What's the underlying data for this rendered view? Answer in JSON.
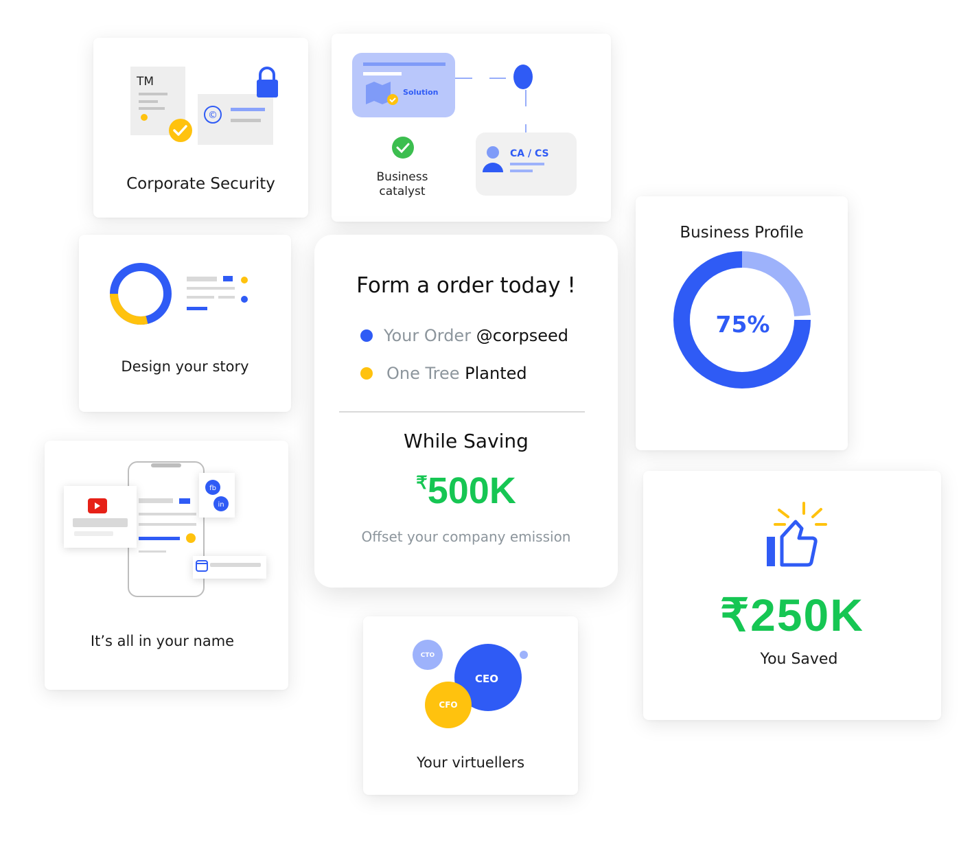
{
  "colors": {
    "blue": "#2f5bf5",
    "light_blue": "#9db2fb",
    "yellow": "#ffc20e",
    "green": "#16c653",
    "grey_text": "#8c959c"
  },
  "corporate_security": {
    "tm_label": "TM",
    "copyright_symbol": "©",
    "title": "Corporate Security"
  },
  "business_catalyst": {
    "solution_label": "Solution",
    "title_line1": "Business",
    "title_line2": "catalyst",
    "ca_cs_label": "CA / CS"
  },
  "design_story": {
    "title": "Design your story"
  },
  "order_card": {
    "heading": "Form a order today !",
    "item1_muted": "Your Order",
    "item1_strong": "@corpseed",
    "item2_muted": "One Tree",
    "item2_strong": "Planted",
    "saving_label": "While Saving",
    "currency_symbol": "₹",
    "amount": "500K",
    "note": "Offset your company emission"
  },
  "business_profile": {
    "title": "Business Profile",
    "percent_label": "75%",
    "completion": 0.75
  },
  "name_card": {
    "fb_label": "fb",
    "in_label": "in",
    "title": "It’s all in your name"
  },
  "virtuellers": {
    "cto_label": "CTO",
    "ceo_label": "CEO",
    "cfo_label": "CFO",
    "title": "Your virtuellers"
  },
  "saved_card": {
    "amount": "₹250K",
    "label": "You Saved"
  }
}
